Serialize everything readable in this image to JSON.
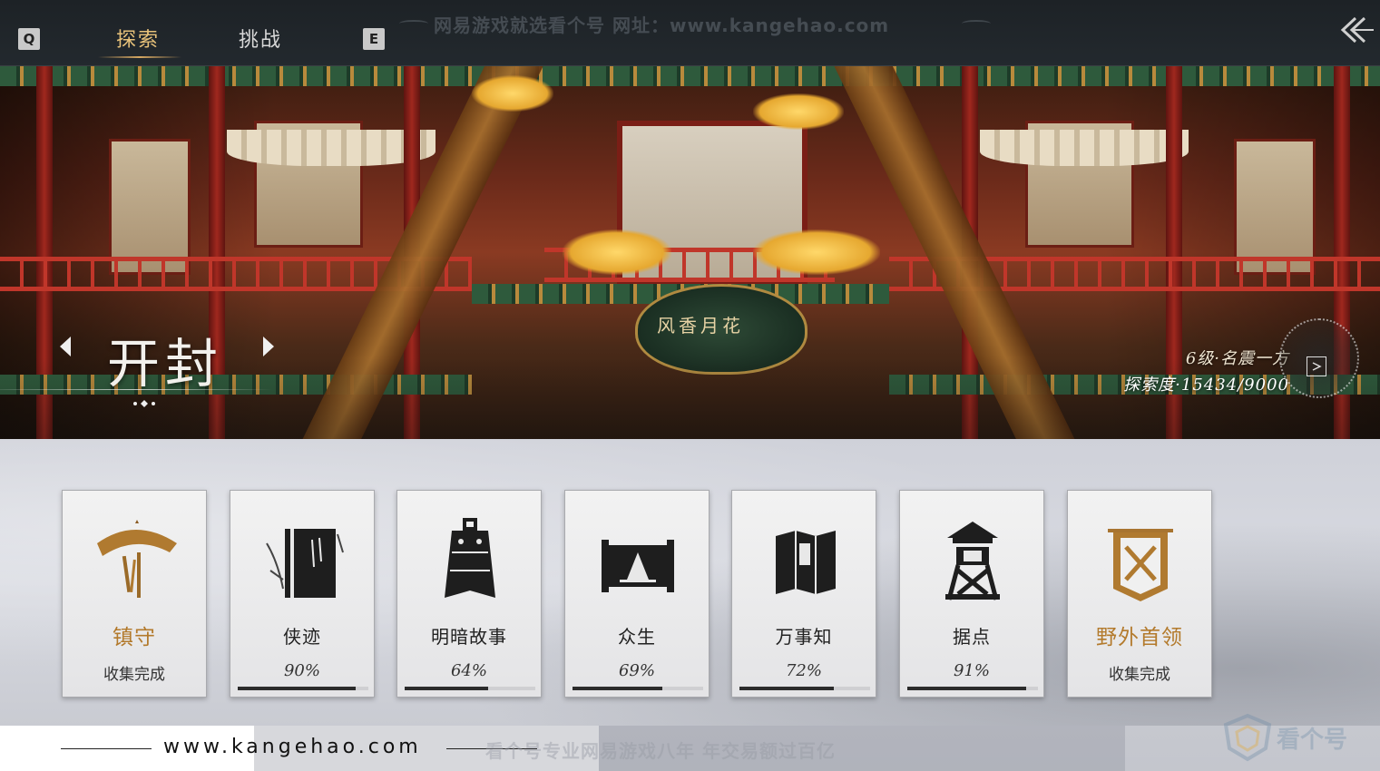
{
  "topbar": {
    "key_left": "Q",
    "key_right": "E",
    "tabs": [
      {
        "label": "探索",
        "active": true
      },
      {
        "label": "挑战",
        "active": false
      }
    ],
    "watermark": "网易游戏就选看个号  网址：www.kangehao.com",
    "back_icon": "double-chevron-left-icon"
  },
  "banner": {
    "city_name": "开封",
    "sign_text": "风香月花",
    "level_text": "6级·名震一方",
    "explore_text": "探索度·15434/9000",
    "map_icon": "map-expand-icon"
  },
  "cards": [
    {
      "label": "镇守",
      "value": "收集完成",
      "complete": true,
      "icon": "bamboo-hat-icon",
      "progress": 1.0
    },
    {
      "label": "侠迹",
      "value": "90%",
      "complete": false,
      "icon": "book-icon",
      "progress": 0.9
    },
    {
      "label": "明暗故事",
      "value": "64%",
      "complete": false,
      "icon": "bell-icon",
      "progress": 0.64
    },
    {
      "label": "众生",
      "value": "69%",
      "complete": false,
      "icon": "scroll-painting-icon",
      "progress": 0.69
    },
    {
      "label": "万事知",
      "value": "72%",
      "complete": false,
      "icon": "folded-map-icon",
      "progress": 0.72
    },
    {
      "label": "据点",
      "value": "91%",
      "complete": false,
      "icon": "watchtower-icon",
      "progress": 0.91
    },
    {
      "label": "野外首领",
      "value": "收集完成",
      "complete": true,
      "icon": "crossed-swords-banner-icon",
      "progress": 1.0
    }
  ],
  "footer": {
    "url": "www.kangehao.com",
    "slogan": "看个号专业网易游戏八年  年交易额过百亿",
    "logo_text": "看个号"
  },
  "colors": {
    "accent_gold": "#b37a2c",
    "tab_active": "#e8c27a",
    "topbar_bg": "#1d2226"
  }
}
